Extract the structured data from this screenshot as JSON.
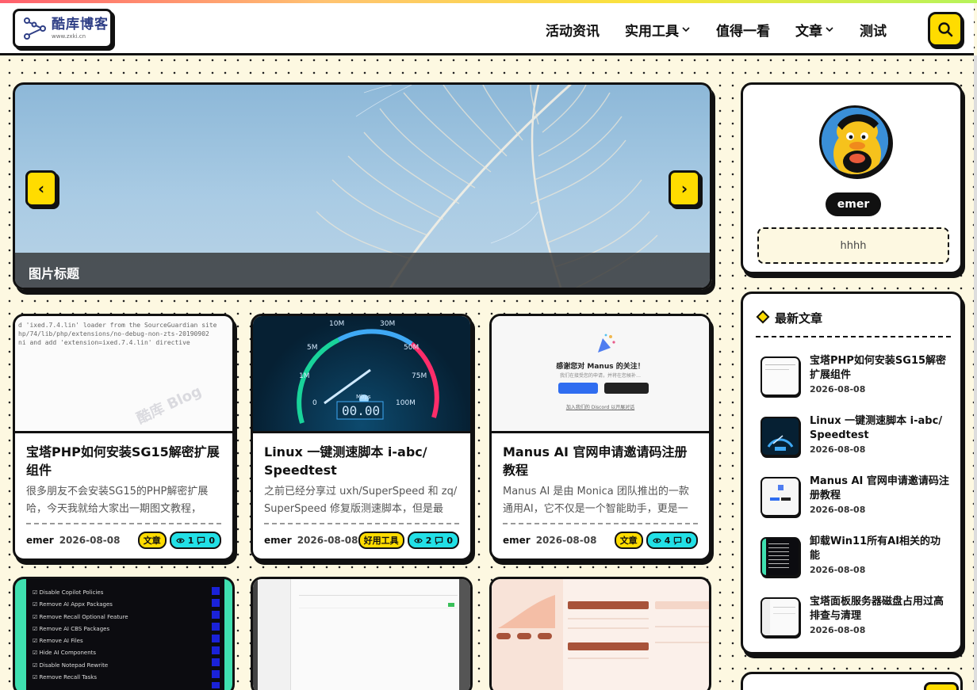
{
  "header": {
    "logo_title": "酷库博客",
    "logo_sub": "www.zxki.cn",
    "nav": [
      {
        "label": "活动资讯",
        "dropdown": false
      },
      {
        "label": "实用工具",
        "dropdown": true
      },
      {
        "label": "值得一看",
        "dropdown": false
      },
      {
        "label": "文章",
        "dropdown": true
      },
      {
        "label": "测试",
        "dropdown": false
      }
    ],
    "icons": {
      "search": "search-icon"
    }
  },
  "slider": {
    "caption": "图片标题",
    "prev_label": "‹",
    "next_label": "›"
  },
  "posts": [
    {
      "title": "宝塔PHP如何安装SG15解密扩展组件",
      "excerpt": "很多朋友不会安装SG15的PHP解密扩展哈，今天我就给大家出一期图文教程，很…",
      "author": "emer",
      "date": "2026-08-08",
      "category": "文章",
      "views": "1",
      "comments": "0",
      "thumb_lines": [
        "d 'ixed.7.4.lin' loader from the SourceGuardian site",
        "hp/74/lib/php/extensions/no-debug-non-zts-20190902",
        "ni and add 'extension=ixed.7.4.lin' directive"
      ]
    },
    {
      "title": "Linux 一键测速脚本 i-abc/ Speedtest",
      "excerpt": "之前已经分享过 uxh/SuperSpeed 和 zq/ SuperSpeed 修复版测速脚本，但是最近…",
      "author": "emer",
      "date": "2026-08-08",
      "category": "好用工具",
      "views": "2",
      "comments": "0",
      "thumb_lines": [
        "10M",
        "30M",
        "5M",
        "50M",
        "1M",
        "75M",
        "0",
        "100M",
        "Mbps",
        "00.00"
      ]
    },
    {
      "title": "Manus AI 官网申请邀请码注册教程",
      "excerpt": "Manus AI 是由 Monica 团队推出的一款通用AI，它不仅是一个智能助手，更是一个…",
      "author": "emer",
      "date": "2026-08-08",
      "category": "文章",
      "views": "4",
      "comments": "0",
      "thumb_lines": [
        "感谢您对 Manus 的关注！",
        "我们在接受您的申请，并将在您候补…",
        "加入我们的 Discord 以开展对话"
      ]
    }
  ],
  "row2_thumbs": {
    "win11_items": [
      "Disable Copilot Policies",
      "Remove AI Appx Packages",
      "Remove Recall Optional Feature",
      "Remove AI CBS Packages",
      "Remove AI Files",
      "Hide AI Components",
      "Disable Notepad Rewrite",
      "Remove Recall Tasks"
    ]
  },
  "profile": {
    "name": "emer",
    "bio": "hhhh"
  },
  "latest": {
    "heading": "最新文章",
    "items": [
      {
        "title": "宝塔PHP如何安装SG15解密扩展组件",
        "date": "2026-08-08"
      },
      {
        "title": "Linux 一键测速脚本 i-abc/ Speedtest",
        "date": "2026-08-08"
      },
      {
        "title": "Manus AI 官网申请邀请码注册教程",
        "date": "2026-08-08"
      },
      {
        "title": "卸载Win11所有AI相关的功能",
        "date": "2026-08-08"
      },
      {
        "title": "宝塔面板服务器磁盘占用过高排查与清理",
        "date": "2026-08-08"
      }
    ]
  },
  "colors": {
    "accent_yellow": "#ffdc00",
    "accent_cyan": "#22e0e6",
    "background": "#fdf8e1",
    "ink": "#111111"
  }
}
